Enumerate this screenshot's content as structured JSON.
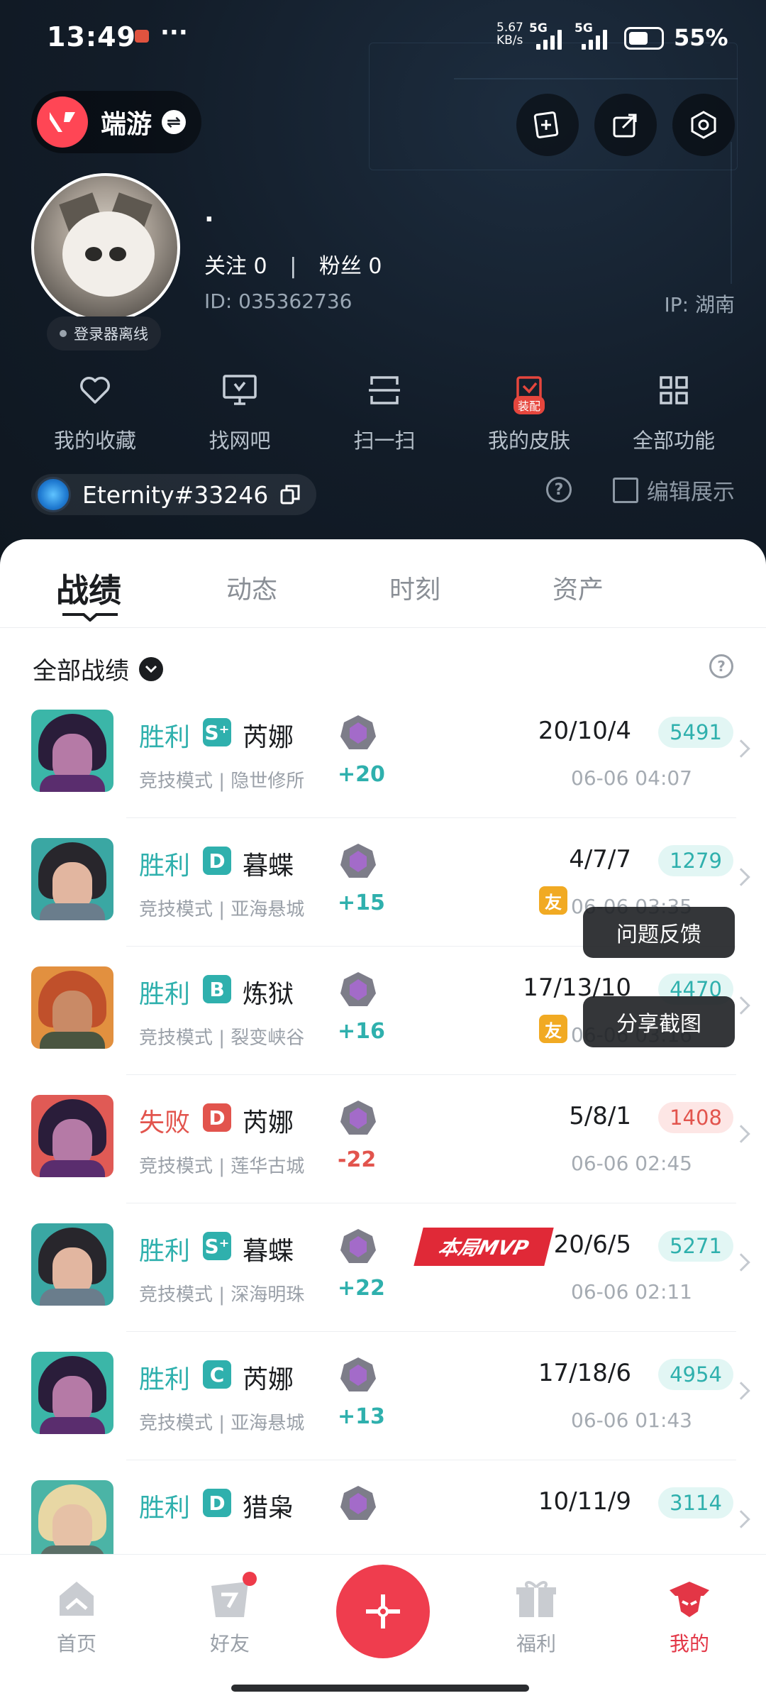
{
  "status_bar": {
    "time": "13:49",
    "dots": "···",
    "speed_value": "5.67",
    "speed_unit": "KB/s",
    "net1": "5G",
    "net2": "5G",
    "battery": "55%"
  },
  "header": {
    "game_name": "端游",
    "swap_icon": "⇌",
    "nickname": ".",
    "follow_label": "关注",
    "follow_count": "0",
    "follow_sep": "|",
    "fans_label": "粉丝",
    "fans_count": "0",
    "user_id": "ID: 035362736",
    "ip": "IP: 湖南",
    "login_status": "登录器离线"
  },
  "quick_actions": [
    {
      "label": "我的收藏",
      "icon": "heart-icon"
    },
    {
      "label": "找网吧",
      "icon": "monitor-icon"
    },
    {
      "label": "扫一扫",
      "icon": "scan-icon"
    },
    {
      "label": "我的皮肤",
      "icon": "skin-icon",
      "badge": "装配"
    },
    {
      "label": "全部功能",
      "icon": "grid-icon"
    }
  ],
  "riot": {
    "name": "Eternity#33246",
    "help": "?",
    "edit_label": "编辑展示"
  },
  "tabs": [
    {
      "label": "战绩",
      "active": true
    },
    {
      "label": "动态",
      "active": false
    },
    {
      "label": "时刻",
      "active": false
    },
    {
      "label": "资产",
      "active": false
    }
  ],
  "filter": {
    "label": "全部战绩",
    "help": "?"
  },
  "matches": [
    {
      "result": "胜利",
      "grade": "S⁺",
      "agent": "芮娜",
      "mode": "竞技模式 | 隐世修所",
      "rp": "+20",
      "kda": "20/10/4",
      "score": "5491",
      "time": "06-06 04:07",
      "win": true
    },
    {
      "result": "胜利",
      "grade": "D",
      "agent": "暮蝶",
      "mode": "竞技模式 | 亚海悬城",
      "rp": "+15",
      "kda": "4/7/7",
      "score": "1279",
      "time": "06-06 03:35",
      "win": true,
      "friend": "友"
    },
    {
      "result": "胜利",
      "grade": "B",
      "agent": "炼狱",
      "mode": "竞技模式 | 裂变峡谷",
      "rp": "+16",
      "kda": "17/13/10",
      "score": "4470",
      "time": "06-06 03:16",
      "win": true,
      "friend": "友"
    },
    {
      "result": "失败",
      "grade": "D",
      "agent": "芮娜",
      "mode": "竞技模式 | 莲华古城",
      "rp": "-22",
      "kda": "5/8/1",
      "score": "1408",
      "time": "06-06 02:45",
      "win": false
    },
    {
      "result": "胜利",
      "grade": "S⁺",
      "agent": "暮蝶",
      "mode": "竞技模式 | 深海明珠",
      "rp": "+22",
      "kda": "20/6/5",
      "score": "5271",
      "time": "06-06 02:11",
      "win": true,
      "mvp": "本局MVP"
    },
    {
      "result": "胜利",
      "grade": "C",
      "agent": "芮娜",
      "mode": "竞技模式 | 亚海悬城",
      "rp": "+13",
      "kda": "17/18/6",
      "score": "4954",
      "time": "06-06 01:43",
      "win": true
    },
    {
      "result": "胜利",
      "grade": "D",
      "agent": "猎枭",
      "mode": "",
      "rp": "",
      "kda": "10/11/9",
      "score": "3114",
      "time": "",
      "win": true
    }
  ],
  "popup_menu": {
    "feedback": "问题反馈",
    "share": "分享截图"
  },
  "bottom_nav": [
    {
      "label": "首页",
      "icon": "home-icon",
      "active": false
    },
    {
      "label": "好友",
      "icon": "friends-icon",
      "active": false
    },
    {
      "label": "福利",
      "icon": "gift-icon",
      "active": false
    },
    {
      "label": "我的",
      "icon": "profile-icon",
      "active": true
    }
  ],
  "colors": {
    "win": "#2fb0ad",
    "loss": "#e2544d",
    "accent": "#ef3d4e",
    "win_score_bg": "#e2f6f4",
    "loss_score_bg": "#fde6e5"
  }
}
